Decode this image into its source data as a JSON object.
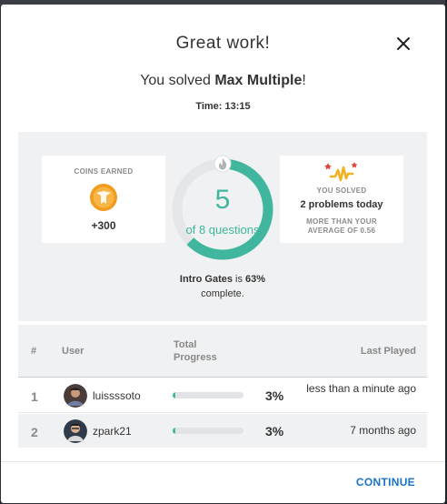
{
  "modal": {
    "title": "Great work!",
    "subtitle_prefix": "You solved ",
    "problem_name": "Max Multiple",
    "subtitle_suffix": "!",
    "time": "Time: 13:15"
  },
  "stats": {
    "coins_label": "COINS EARNED",
    "coins_value": "+300",
    "ring_value": "5",
    "ring_sub": "of 8 questions",
    "ring_progress": 0.625,
    "solved_label": "YOU SOLVED",
    "solved_value": "2 problems today",
    "solved_note_line1": "MORE THAN YOUR",
    "solved_note_line2": "AVERAGE OF 0.56",
    "course_name": "Intro Gates",
    "course_mid": " is ",
    "course_pct": "63%",
    "course_tail": "complete."
  },
  "table": {
    "headers": {
      "rank": "#",
      "user": "User",
      "progress_line1": "Total",
      "progress_line2": "Progress",
      "last_played": "Last Played"
    },
    "rows": [
      {
        "rank": "1",
        "user": "luissssoto",
        "progress": 0.03,
        "progress_label": "3%",
        "last_played": "less than a minute ago"
      },
      {
        "rank": "2",
        "user": "zpark21",
        "progress": 0.03,
        "progress_label": "3%",
        "last_played": "7 months ago"
      }
    ]
  },
  "footer": {
    "continue_label": "CONTINUE"
  },
  "colors": {
    "accent_green": "#3fb69d",
    "link_blue": "#1a73c8",
    "coin_orange": "#f29c1f"
  },
  "icons": {
    "close": "close-icon",
    "coin": "coin-icon",
    "flame": "flame-icon",
    "solved": "sparkle-chart-icon"
  }
}
